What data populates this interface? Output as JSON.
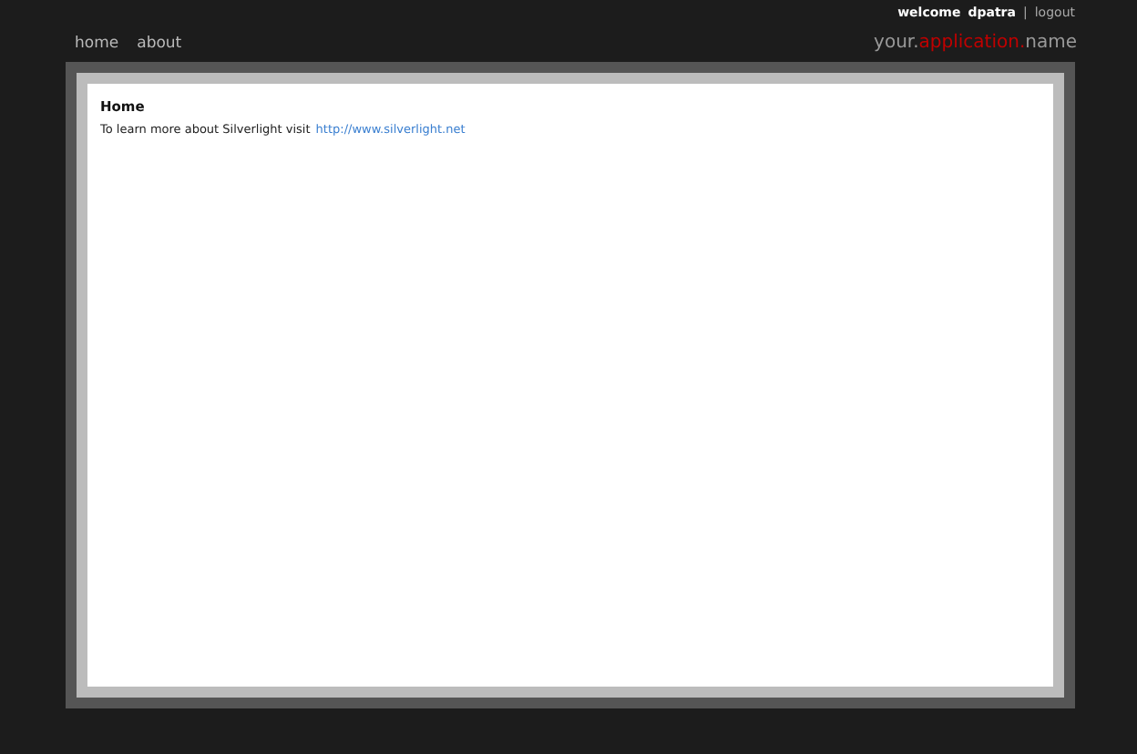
{
  "user_bar": {
    "welcome": "welcome",
    "user": "dpatra",
    "separator": "|",
    "logout": "logout"
  },
  "nav": [
    {
      "label": "home"
    },
    {
      "label": "about"
    }
  ],
  "app_name": [
    {
      "text": "your.",
      "kind": "plain"
    },
    {
      "text": "application.",
      "kind": "accent"
    },
    {
      "text": "name",
      "kind": "plain"
    }
  ],
  "page": {
    "title": "Home",
    "text": "To learn more about Silverlight visit",
    "link": "http://www.silverlight.net"
  }
}
